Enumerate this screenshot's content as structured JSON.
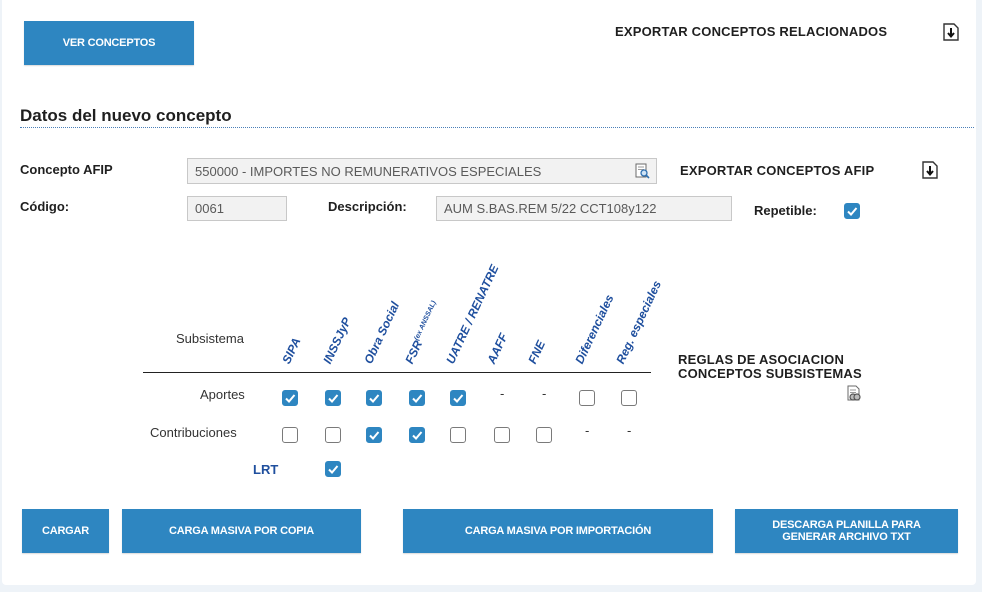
{
  "buttons": {
    "ver_conceptos": "VER CONCEPTOS",
    "cargar": "CARGAR",
    "carga_copia": "CARGA MASIVA POR COPIA",
    "carga_importacion": "CARGA MASIVA POR IMPORTACIÓN",
    "descarga_planilla": "DESCARGA PLANILLA PARA GENERAR ARCHIVO TXT"
  },
  "export_relacionados": "EXPORTAR CONCEPTOS RELACIONADOS",
  "section_title": "Datos del nuevo concepto",
  "form": {
    "concepto_afip_label": "Concepto AFIP",
    "concepto_afip_value": "550000 - IMPORTES NO REMUNERATIVOS ESPECIALES",
    "export_afip": "EXPORTAR CONCEPTOS AFIP",
    "codigo_label": "Código:",
    "codigo_value": "0061",
    "descripcion_label": "Descripción:",
    "descripcion_value": "AUM S.BAS.REM 5/22 CCT108y122",
    "repetible_label": "Repetible:",
    "repetible_checked": true
  },
  "grid": {
    "subsistema_label": "Subsistema",
    "columns": [
      "SIPA",
      "INSSJyP",
      "Obra Social",
      "FSR",
      "UATRE / RENATRE",
      "AAFF",
      "FNE",
      "Diferenciales",
      "Reg. especiales"
    ],
    "fsr_superscript": "(ex ANSSAL)",
    "rows": [
      {
        "label": "Aportes",
        "cells": [
          "checked",
          "checked",
          "checked",
          "checked",
          "checked",
          "-",
          "-",
          "unchecked",
          "unchecked"
        ]
      },
      {
        "label": "Contribuciones",
        "cells": [
          "unchecked",
          "unchecked",
          "checked",
          "checked",
          "unchecked",
          "unchecked",
          "unchecked",
          "-",
          "-"
        ]
      }
    ],
    "lrt_label": "LRT",
    "lrt_checked": true
  },
  "reglas": "REGLAS DE ASOCIACION CONCEPTOS SUBSISTEMAS",
  "colors": {
    "accent": "#2e86c1",
    "header_text": "#1f4f9e"
  },
  "icons": [
    "download-icon",
    "search-document-icon",
    "view-document-icon",
    "checkmark-icon"
  ]
}
